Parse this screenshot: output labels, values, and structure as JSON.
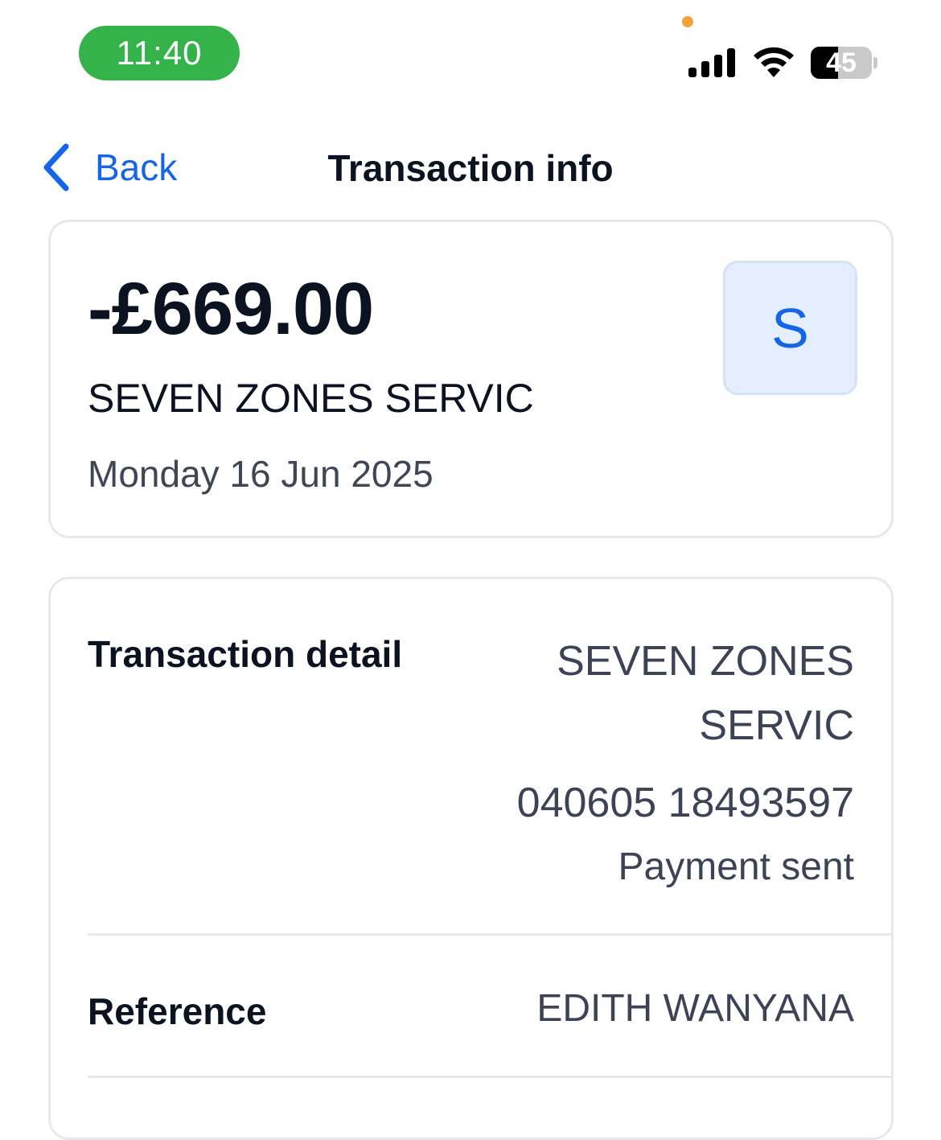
{
  "status_bar": {
    "time": "11:40",
    "battery_percent": "45",
    "battery_level": 0.45,
    "privacy_indicator_color": "#f5a03a",
    "time_pill_color": "#34b34a"
  },
  "nav": {
    "back_label": "Back",
    "title": "Transaction info",
    "accent_color": "#1565e6"
  },
  "summary": {
    "amount": "-£669.00",
    "merchant": "SEVEN ZONES SERVIC",
    "date": "Monday 16 Jun 2025",
    "avatar_letter": "S"
  },
  "details": {
    "transaction_detail_label": "Transaction detail",
    "transaction_detail_name_line1": "SEVEN ZONES",
    "transaction_detail_name_line2": "SERVIC",
    "transaction_detail_account": "040605 18493597",
    "transaction_detail_status": "Payment sent",
    "reference_label": "Reference",
    "reference_value": "EDITH WANYANA"
  },
  "icons": [
    "chevron-left-icon",
    "cellular-signal-icon",
    "wifi-icon",
    "battery-icon"
  ]
}
